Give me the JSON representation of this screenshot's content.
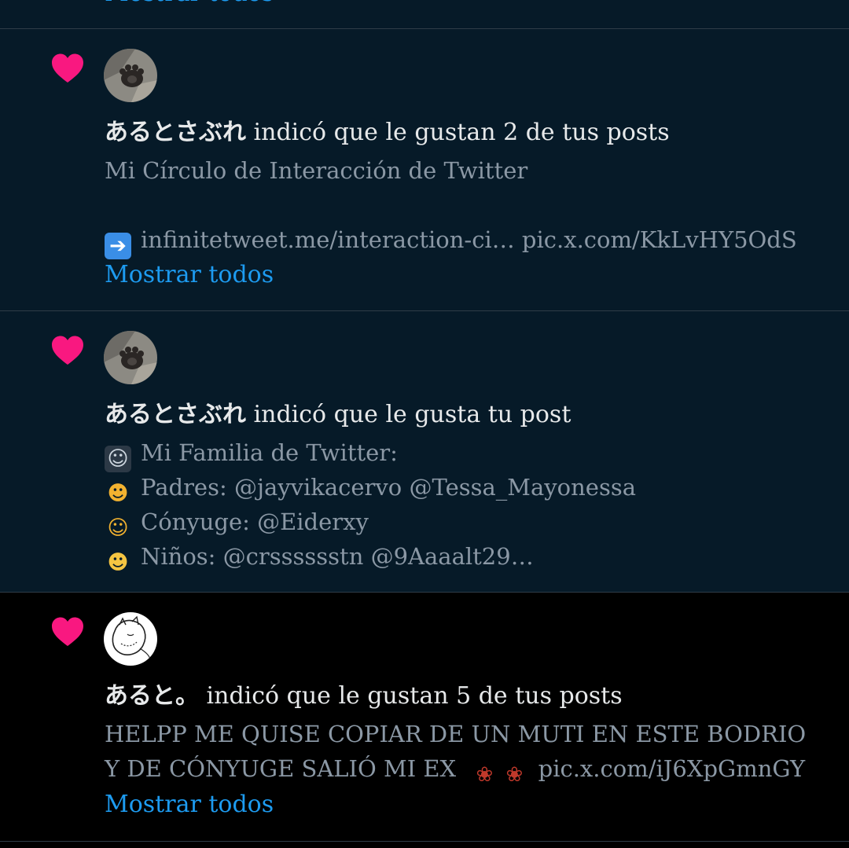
{
  "colors": {
    "unread_background": "#061a28",
    "read_background": "#000000",
    "heart": "#f91880",
    "link": "#1d9bf0",
    "preview_text": "#8b98a5",
    "title_text": "#e7e9ea"
  },
  "top_partial": {
    "show_all": "Mostrar todos"
  },
  "notifications": [
    {
      "icon": "heart-icon",
      "avatar": "cat-paw-avatar",
      "user_name": "あるとさぶれ",
      "action": " indicó que le gustan 2 de tus posts",
      "preview_lines": [
        "Mi Círculo de Interacción de Twitter",
        "",
        "infinitetweet.me/interaction-ci… pic.x.com/KkLvHY5OdS"
      ],
      "preview_emojis": [
        "",
        "",
        "right-arrow-emoji"
      ],
      "show_all": "Mostrar todos"
    },
    {
      "icon": "heart-icon",
      "avatar": "cat-paw-avatar",
      "user_name": "あるとさぶれ",
      "action": " indicó que le gusta tu post",
      "preview_lines": [
        "Mi Familia de Twitter:",
        "Padres: @jayvikacervo @Tessa_Mayonessa",
        "Cónyuge: @Eiderxy",
        "Niños: @crsssssstn @9Aaaalt29…"
      ],
      "preview_emojis": [
        "family-emoji",
        "couple-emoji",
        "bride-emoji",
        "baby-emoji"
      ]
    },
    {
      "icon": "heart-icon",
      "avatar": "sketch-avatar",
      "user_name": "あると。",
      "action": " indicó que le gustan 5 de tus posts",
      "preview_text": "HELPP ME QUISE COPIAR DE UN MUTI EN ESTE BODRIO Y DE CÓNYUGE SALIÓ MI EX",
      "preview_suffix": "pic.x.com/iJ6XpGmnGY",
      "preview_emojis": [
        "wilted-rose-emoji",
        "wilted-rose-emoji"
      ],
      "show_all": "Mostrar todos"
    }
  ]
}
